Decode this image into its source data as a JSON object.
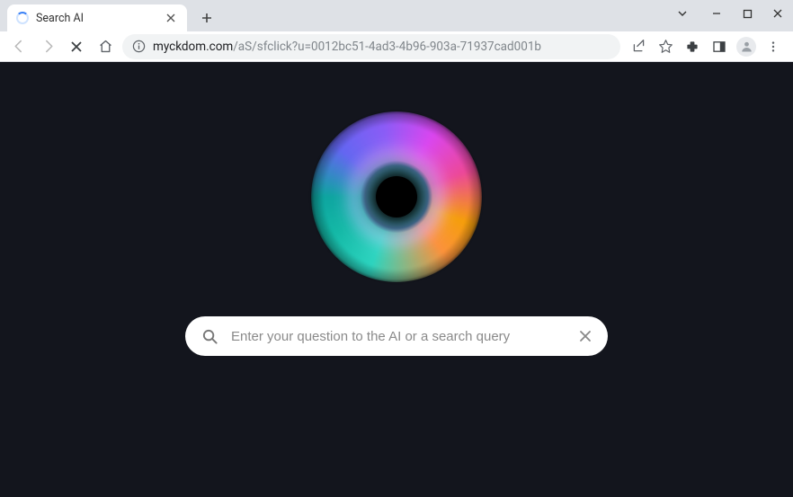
{
  "tab": {
    "title": "Search AI"
  },
  "address": {
    "host": "myckdom.com",
    "path": "/aS/sfclick?u=0012bc51-4ad3-4b96-903a-71937cad001b"
  },
  "search": {
    "placeholder": "Enter your question to the AI or a search query",
    "value": ""
  }
}
